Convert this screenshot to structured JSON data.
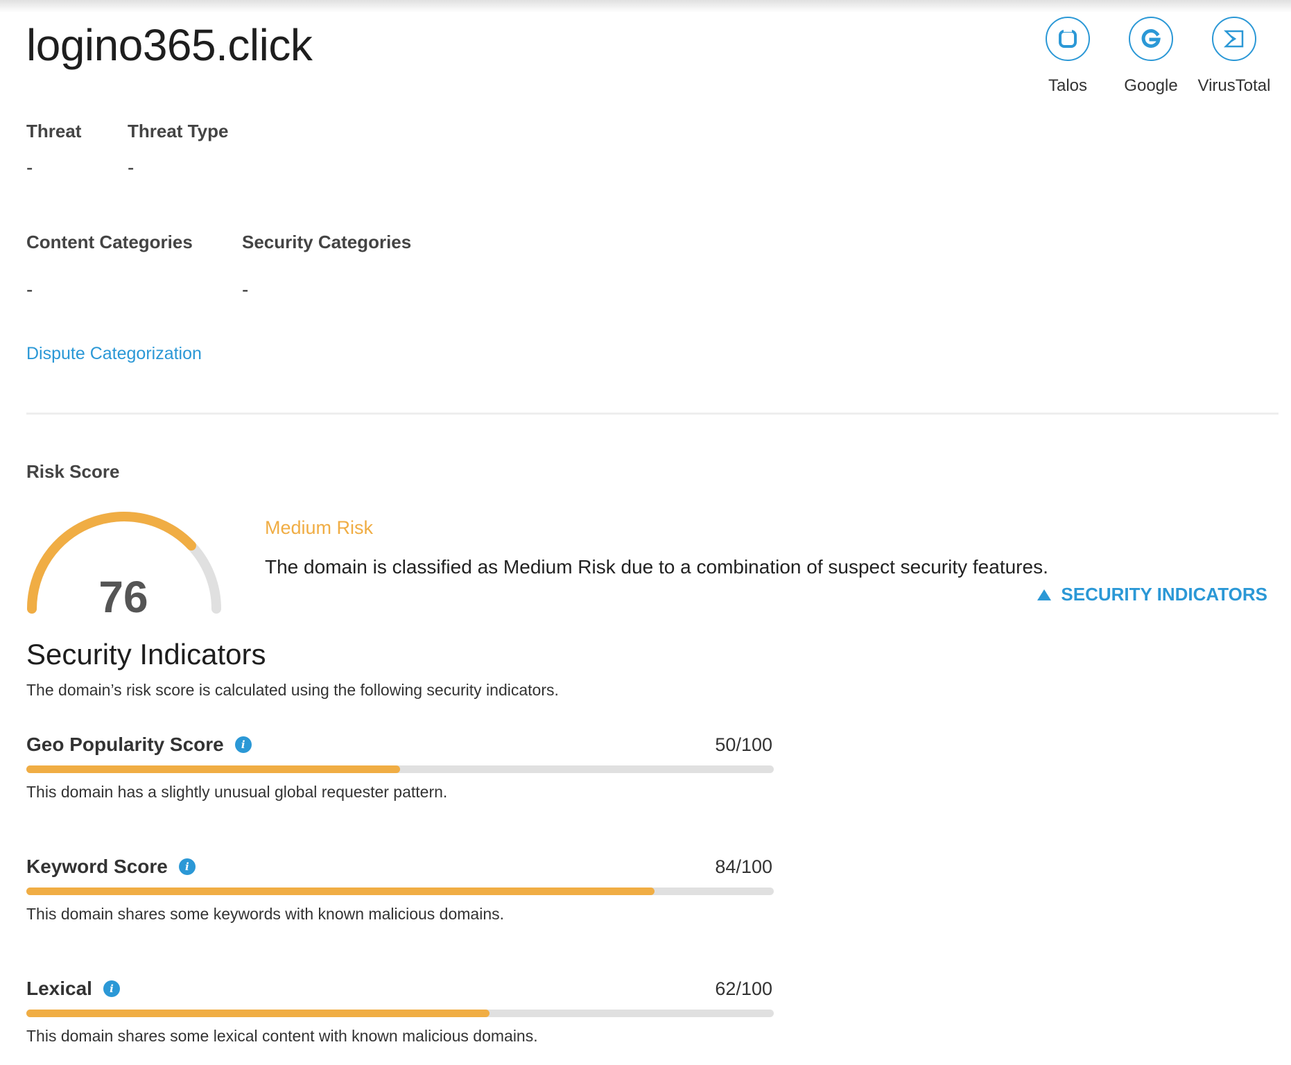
{
  "domain": "logino365.click",
  "external_links": [
    {
      "label": "Talos",
      "icon": "talos-icon"
    },
    {
      "label": "Google",
      "icon": "google-icon"
    },
    {
      "label": "VirusTotal",
      "icon": "virustotal-icon"
    }
  ],
  "threat": {
    "label": "Threat",
    "value": "-"
  },
  "threat_type": {
    "label": "Threat Type",
    "value": "-"
  },
  "content_categories": {
    "label": "Content Categories",
    "value": "-"
  },
  "security_categories": {
    "label": "Security Categories",
    "value": "-"
  },
  "dispute_link": "Dispute Categorization",
  "risk": {
    "label": "Risk Score",
    "score": "76",
    "score_fraction": 0.76,
    "level": "Medium Risk",
    "description": "The domain is classified as Medium Risk due to a combination of suspect security features.",
    "toggle_label": "SECURITY INDICATORS"
  },
  "indicators_section": {
    "title": "Security Indicators",
    "subtitle": "The domain’s risk score is calculated using the following security indicators."
  },
  "indicators": [
    {
      "name": "Geo Popularity Score",
      "score": "50/100",
      "fraction": 0.5,
      "description": "This domain has a slightly unusual global requester pattern."
    },
    {
      "name": "Keyword Score",
      "score": "84/100",
      "fraction": 0.84,
      "description": "This domain shares some keywords with known malicious domains."
    },
    {
      "name": "Lexical",
      "score": "62/100",
      "fraction": 0.62,
      "description": "This domain shares some lexical content with known malicious domains."
    }
  ],
  "colors": {
    "accent_blue": "#2b98d6",
    "risk_orange": "#f0ad44",
    "track_gray": "#e0e0e0"
  }
}
